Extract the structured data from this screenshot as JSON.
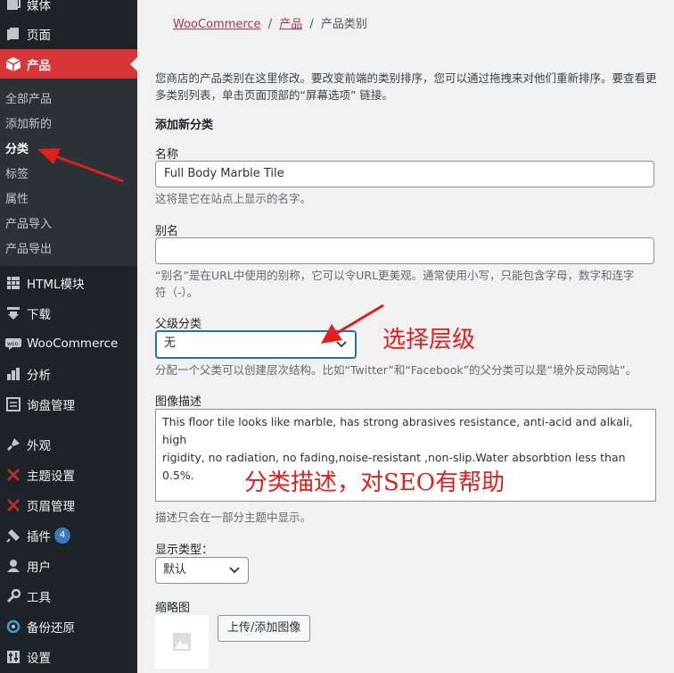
{
  "sidebar": {
    "items_top": [
      {
        "label": "媒体",
        "icon": "media-icon"
      },
      {
        "label": "页面",
        "icon": "page-icon"
      },
      {
        "label": "产品",
        "icon": "product-box-icon"
      }
    ],
    "submenu": [
      "全部产品",
      "添加新的",
      "分类",
      "标签",
      "属性",
      "产品导入",
      "产品导出"
    ],
    "items_bottom": [
      {
        "label": "HTML模块",
        "icon": "html-module-icon"
      },
      {
        "label": "下载",
        "icon": "download-icon"
      },
      {
        "label": "WooCommerce",
        "icon": "woocommerce-icon"
      },
      {
        "label": "分析",
        "icon": "analytics-icon"
      },
      {
        "label": "询盘管理",
        "icon": "inquiry-icon"
      },
      {
        "label": "外观",
        "icon": "appearance-brush-icon"
      },
      {
        "label": "主题设置",
        "icon": "theme-settings-icon"
      },
      {
        "label": "页眉管理",
        "icon": "header-manager-icon"
      },
      {
        "label": "插件",
        "icon": "plugin-icon",
        "badge": "4"
      },
      {
        "label": "用户",
        "icon": "user-icon"
      },
      {
        "label": "工具",
        "icon": "wrench-icon"
      },
      {
        "label": "备份还原",
        "icon": "backup-icon"
      },
      {
        "label": "设置",
        "icon": "settings-icon"
      }
    ]
  },
  "breadcrumb": {
    "root": "WooCommerce",
    "parent": "产品",
    "current": "产品类别",
    "sep": "/"
  },
  "intro": {
    "line1": "您商店的产品类别在这里修改。要改变前端的类别排序，您可以通过拖拽来对他们重新排序。要查看更",
    "line2": "多类别列表，单击页面顶部的“屏幕选项” 链接。"
  },
  "form": {
    "heading": "添加新分类",
    "name": {
      "label": "名称",
      "value": "Full Body Marble Tile",
      "help": "这将是它在站点上显示的名字。"
    },
    "slug": {
      "label": "别名",
      "value": "",
      "help_line1": "“别名”是在URL中使用的别称，它可以令URL更美观。通常使用小写，只能包含字母，数字和连字",
      "help_line2": "符（-）。"
    },
    "parent": {
      "label": "父级分类",
      "selected": "无",
      "help": "分配一个父类可以创建层次结构。比如“Twitter”和“Facebook”的父分类可以是“境外反动网站”。"
    },
    "description": {
      "label": "图像描述",
      "line1": "This floor tile looks like marble, has strong abrasives resistance, anti-acid and alkali, high",
      "line2": "rigidity, no radiation, no fading,noise-resistant ,non-slip.Water absorbtion less than",
      "line3": "0.5%.",
      "help": "描述只会在一部分主题中显示。"
    },
    "display_type": {
      "label": "显示类型：",
      "selected": "默认"
    },
    "thumbnail": {
      "label": "缩略图",
      "button": "上传/添加图像"
    }
  },
  "annotations": {
    "level": "选择层级",
    "seo": "分类描述，对SEO有帮助",
    "color": "#e0201d"
  },
  "colors": {
    "active_menu": "#d63638",
    "sidebar": "#1d2327",
    "submenu": "#2c3338",
    "focus": "#2271b1"
  }
}
